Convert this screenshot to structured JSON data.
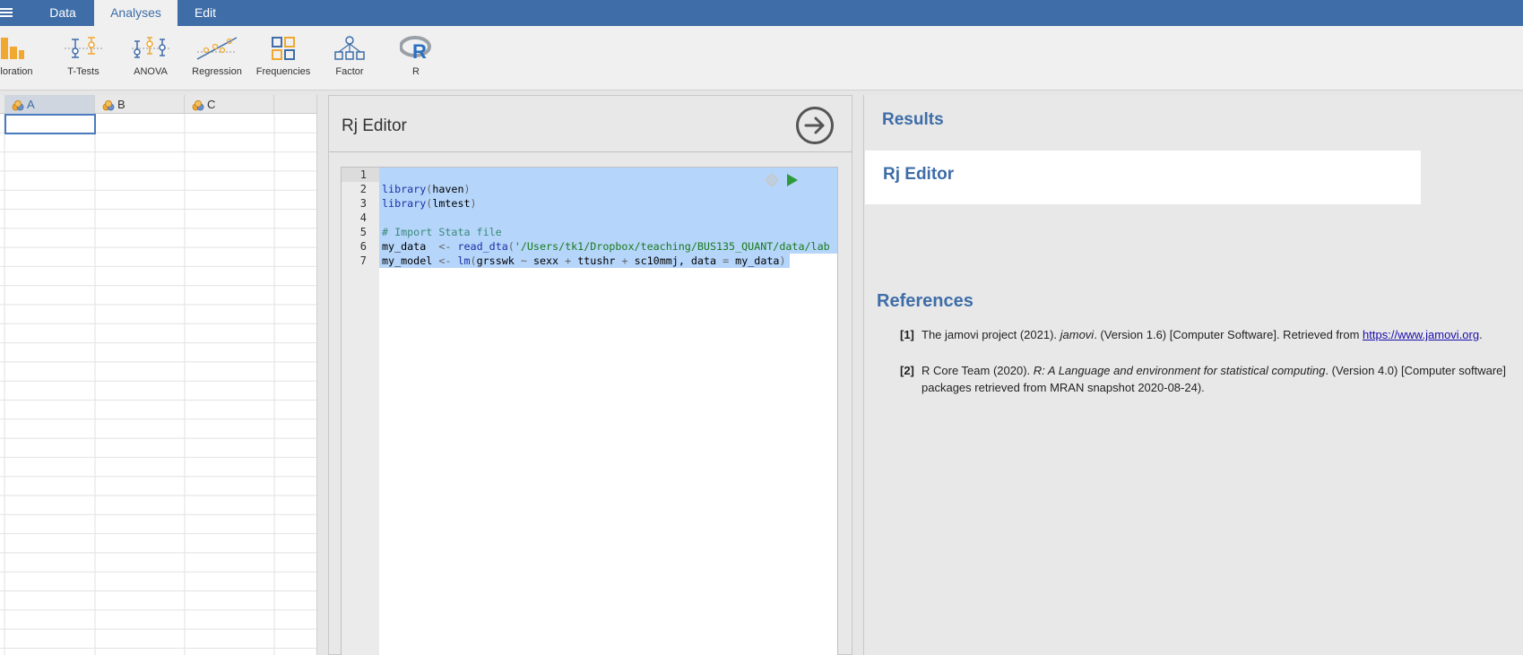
{
  "menu": {
    "tabs": [
      {
        "label": "Data"
      },
      {
        "label": "Analyses"
      },
      {
        "label": "Edit"
      }
    ]
  },
  "ribbon": {
    "tools": [
      {
        "label": "Exploration"
      },
      {
        "label": "T-Tests"
      },
      {
        "label": "ANOVA"
      },
      {
        "label": "Regression"
      },
      {
        "label": "Frequencies"
      },
      {
        "label": "Factor"
      },
      {
        "label": "R"
      }
    ]
  },
  "sheet": {
    "columns": [
      {
        "label": "A"
      },
      {
        "label": "B"
      },
      {
        "label": "C"
      }
    ]
  },
  "editor": {
    "title": "Rj Editor",
    "line_numbers": [
      "1",
      "2",
      "3",
      "4",
      "5",
      "6",
      "7"
    ],
    "lines": [
      "",
      "library(haven)",
      "library(lmtest)",
      "",
      "# Import Stata file",
      "my_data  <- read_dta('/Users/tk1/Dropbox/teaching/BUS135_QUANT/data/lab",
      "my_model <- lm(grsswk ~ sexx + ttushr + sc10mmj, data = my_data)"
    ]
  },
  "results": {
    "title": "Results",
    "card_title": "Rj Editor",
    "references_title": "References",
    "refs": [
      {
        "num": "[1]",
        "prefix": "The jamovi project (2021). ",
        "italic": "jamovi",
        "mid": ". (Version 1.6) [Computer Software]. Retrieved from ",
        "link": "https://www.jamovi.org",
        "suffix": "."
      },
      {
        "num": "[2]",
        "prefix": "R Core Team (2020). ",
        "italic": "R: A Language and environment for statistical computing",
        "mid": ". (Version 4.0) [Computer software]",
        "line2": "packages retrieved from MRAN snapshot 2020-08-24)."
      }
    ]
  },
  "colors": {
    "brand": "#3e6da8",
    "selection": "#b5d5fb",
    "run_green": "#2e9a3a"
  }
}
